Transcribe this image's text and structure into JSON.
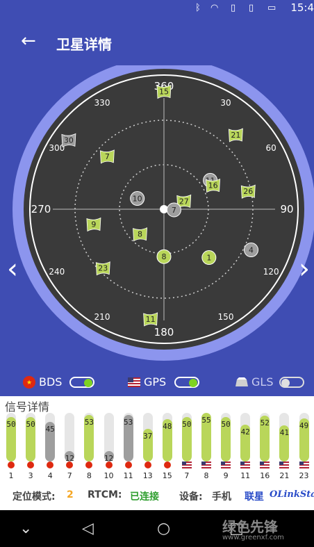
{
  "status_bar": {
    "time": "15:4",
    "icons": [
      "bluetooth-icon",
      "wifi-icon",
      "sim1-icon",
      "sim2-icon",
      "battery-icon"
    ]
  },
  "header": {
    "title": "卫星详情",
    "back_icon": "arrow-left-icon"
  },
  "compass": {
    "labels": [
      {
        "deg": 0,
        "text": "360"
      },
      {
        "deg": 30,
        "text": "30"
      },
      {
        "deg": 60,
        "text": "60"
      },
      {
        "deg": 90,
        "text": "90"
      },
      {
        "deg": 120,
        "text": "120"
      },
      {
        "deg": 150,
        "text": "150"
      },
      {
        "deg": 180,
        "text": "180"
      },
      {
        "deg": 210,
        "text": "210"
      },
      {
        "deg": 240,
        "text": "240"
      },
      {
        "deg": 270,
        "text": "270"
      },
      {
        "deg": 300,
        "text": "300"
      },
      {
        "deg": 330,
        "text": "330"
      }
    ]
  },
  "satellites": [
    {
      "prn": "15",
      "system": "BDS",
      "used": true,
      "azimuth": 0,
      "elevation": 8
    },
    {
      "prn": "30",
      "system": "BDS",
      "used": false,
      "azimuth": 306,
      "elevation": 8
    },
    {
      "prn": "7",
      "system": "BDS",
      "used": true,
      "azimuth": 313,
      "elevation": 36
    },
    {
      "prn": "21",
      "system": "BDS",
      "used": true,
      "azimuth": 44,
      "elevation": 18
    },
    {
      "prn": "11",
      "system": "GPS",
      "used": false,
      "azimuth": 58,
      "elevation": 52
    },
    {
      "prn": "16",
      "system": "BDS",
      "used": true,
      "azimuth": 64,
      "elevation": 52
    },
    {
      "prn": "26",
      "system": "BDS",
      "used": true,
      "azimuth": 78,
      "elevation": 30
    },
    {
      "prn": "10",
      "system": "GPS",
      "used": false,
      "azimuth": 292,
      "elevation": 70
    },
    {
      "prn": "27",
      "system": "BDS",
      "used": true,
      "azimuth": 68,
      "elevation": 75
    },
    {
      "prn": "7",
      "system": "GPS",
      "used": false,
      "azimuth": 94,
      "elevation": 83
    },
    {
      "prn": "9",
      "system": "BDS",
      "used": true,
      "azimuth": 258,
      "elevation": 40
    },
    {
      "prn": "8",
      "system": "BDS",
      "used": true,
      "azimuth": 224,
      "elevation": 66
    },
    {
      "prn": "8",
      "system": "GPS",
      "used": true,
      "azimuth": 180,
      "elevation": 57
    },
    {
      "prn": "4",
      "system": "GPS",
      "used": false,
      "azimuth": 115,
      "elevation": 23
    },
    {
      "prn": "1",
      "system": "GPS",
      "used": true,
      "azimuth": 137,
      "elevation": 44
    },
    {
      "prn": "23",
      "system": "BDS",
      "used": true,
      "azimuth": 226,
      "elevation": 31
    },
    {
      "prn": "11",
      "system": "BDS",
      "used": true,
      "azimuth": 187,
      "elevation": 13
    }
  ],
  "systems": [
    {
      "name": "BDS",
      "enabled": true,
      "flag": "cn-flag-icon"
    },
    {
      "name": "GPS",
      "enabled": true,
      "flag": "us-flag-icon"
    },
    {
      "name": "GLS",
      "enabled": false,
      "flag": "ru-flag-icon"
    }
  ],
  "signal": {
    "title": "信号详情",
    "bars": [
      {
        "prn": "1",
        "snr": 50,
        "system": "BDS",
        "used": true
      },
      {
        "prn": "3",
        "snr": 50,
        "system": "BDS",
        "used": true
      },
      {
        "prn": "4",
        "snr": 45,
        "system": "BDS",
        "used": false
      },
      {
        "prn": "7",
        "snr": 12,
        "system": "BDS",
        "used": false
      },
      {
        "prn": "8",
        "snr": 53,
        "system": "BDS",
        "used": true
      },
      {
        "prn": "10",
        "snr": 12,
        "system": "BDS",
        "used": false
      },
      {
        "prn": "11",
        "snr": 53,
        "system": "BDS",
        "used": false
      },
      {
        "prn": "13",
        "snr": 37,
        "system": "BDS",
        "used": true
      },
      {
        "prn": "15",
        "snr": 48,
        "system": "BDS",
        "used": true
      },
      {
        "prn": "7",
        "snr": 50,
        "system": "GPS",
        "used": true
      },
      {
        "prn": "8",
        "snr": 55,
        "system": "GPS",
        "used": true
      },
      {
        "prn": "9",
        "snr": 50,
        "system": "GPS",
        "used": true
      },
      {
        "prn": "11",
        "snr": 42,
        "system": "GPS",
        "used": true
      },
      {
        "prn": "16",
        "snr": 52,
        "system": "GPS",
        "used": true
      },
      {
        "prn": "21",
        "snr": 41,
        "system": "GPS",
        "used": true
      },
      {
        "prn": "23",
        "snr": 49,
        "system": "GPS",
        "used": true
      }
    ]
  },
  "info": {
    "mode_label": "定位模式:",
    "mode_value": "2",
    "rtcm_label": "RTCM:",
    "rtcm_value": "已连接",
    "device_label": "设备:",
    "device_value": "手机",
    "brand1": "联星",
    "brand2": "OLinkSta"
  },
  "watermark": {
    "text": "绿色先锋",
    "url": "www.greenxf.com"
  },
  "colors": {
    "header_bg": "#3f4db3",
    "ring": "#8c95ee",
    "radar_bg": "#3a3a3a",
    "used": "#b9d65a",
    "unused": "#9e9e9e",
    "mode_value": "#f5a623",
    "rtcm_value": "#2e9e2e",
    "brand": "#2a4cc8"
  }
}
